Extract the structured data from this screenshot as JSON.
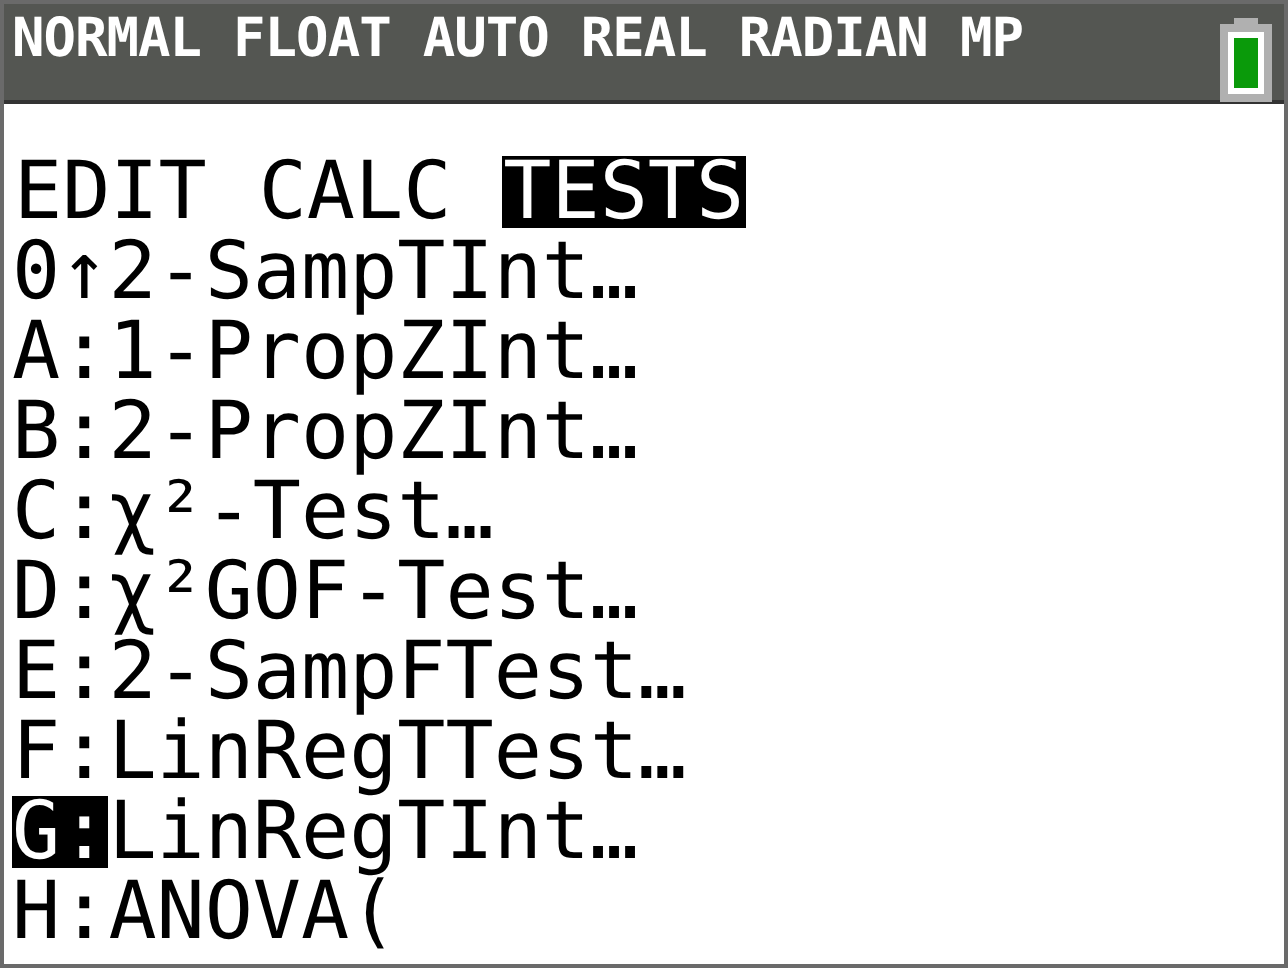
{
  "status_bar": {
    "modes": [
      "NORMAL",
      "FLOAT",
      "AUTO",
      "REAL",
      "RADIAN",
      "MP"
    ]
  },
  "tabs": [
    {
      "label": "EDIT",
      "selected": false
    },
    {
      "label": "CALC",
      "selected": false
    },
    {
      "label": "TESTS",
      "selected": true
    }
  ],
  "items": [
    {
      "key": "0",
      "separator": "↑",
      "label": "2-SampTInt…",
      "selected": false
    },
    {
      "key": "A",
      "separator": ":",
      "label": "1-PropZInt…",
      "selected": false
    },
    {
      "key": "B",
      "separator": ":",
      "label": "2-PropZInt…",
      "selected": false
    },
    {
      "key": "C",
      "separator": ":",
      "label": "χ²-Test…",
      "selected": false
    },
    {
      "key": "D",
      "separator": ":",
      "label": "χ²GOF-Test…",
      "selected": false
    },
    {
      "key": "E",
      "separator": ":",
      "label": "2-SampFTest…",
      "selected": false
    },
    {
      "key": "F",
      "separator": ":",
      "label": "LinRegTTest…",
      "selected": false
    },
    {
      "key": "G",
      "separator": ":",
      "label": "LinRegTInt…",
      "selected": true
    },
    {
      "key": "H",
      "separator": ":",
      "label": "ANOVA(",
      "selected": false
    }
  ]
}
